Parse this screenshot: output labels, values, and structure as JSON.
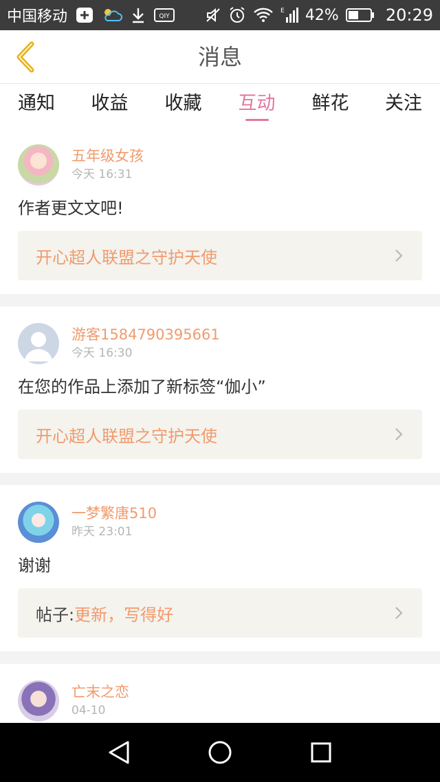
{
  "status_bar": {
    "carrier": "中国移动",
    "battery": "42%",
    "time": "20:29"
  },
  "header": {
    "title": "消息"
  },
  "tabs": [
    {
      "label": "通知",
      "active": false
    },
    {
      "label": "收益",
      "active": false
    },
    {
      "label": "收藏",
      "active": false
    },
    {
      "label": "互动",
      "active": true
    },
    {
      "label": "鲜花",
      "active": false
    },
    {
      "label": "关注",
      "active": false
    }
  ],
  "messages": [
    {
      "username": "五年级女孩",
      "time": "今天 16:31",
      "text": "作者更文文吧!",
      "link_prefix": "",
      "link_text": "开心超人联盟之守护天使"
    },
    {
      "username": "游客1584790395661",
      "time": "今天 16:30",
      "text": "在您的作品上添加了新标签“伽小”",
      "link_prefix": "",
      "link_text": "开心超人联盟之守护天使"
    },
    {
      "username": "一梦繁唐510",
      "time": "昨天 23:01",
      "text": "谢谢",
      "link_prefix": "帖子:",
      "link_text": "更新，写得好"
    },
    {
      "username": "亡末之恋",
      "time": "04-10"
    }
  ],
  "colors": {
    "accent_pink": "#e0779e",
    "username_orange": "#f19a6c",
    "link_bg": "#f4f3ee",
    "back_arrow": "#e3b21a"
  }
}
